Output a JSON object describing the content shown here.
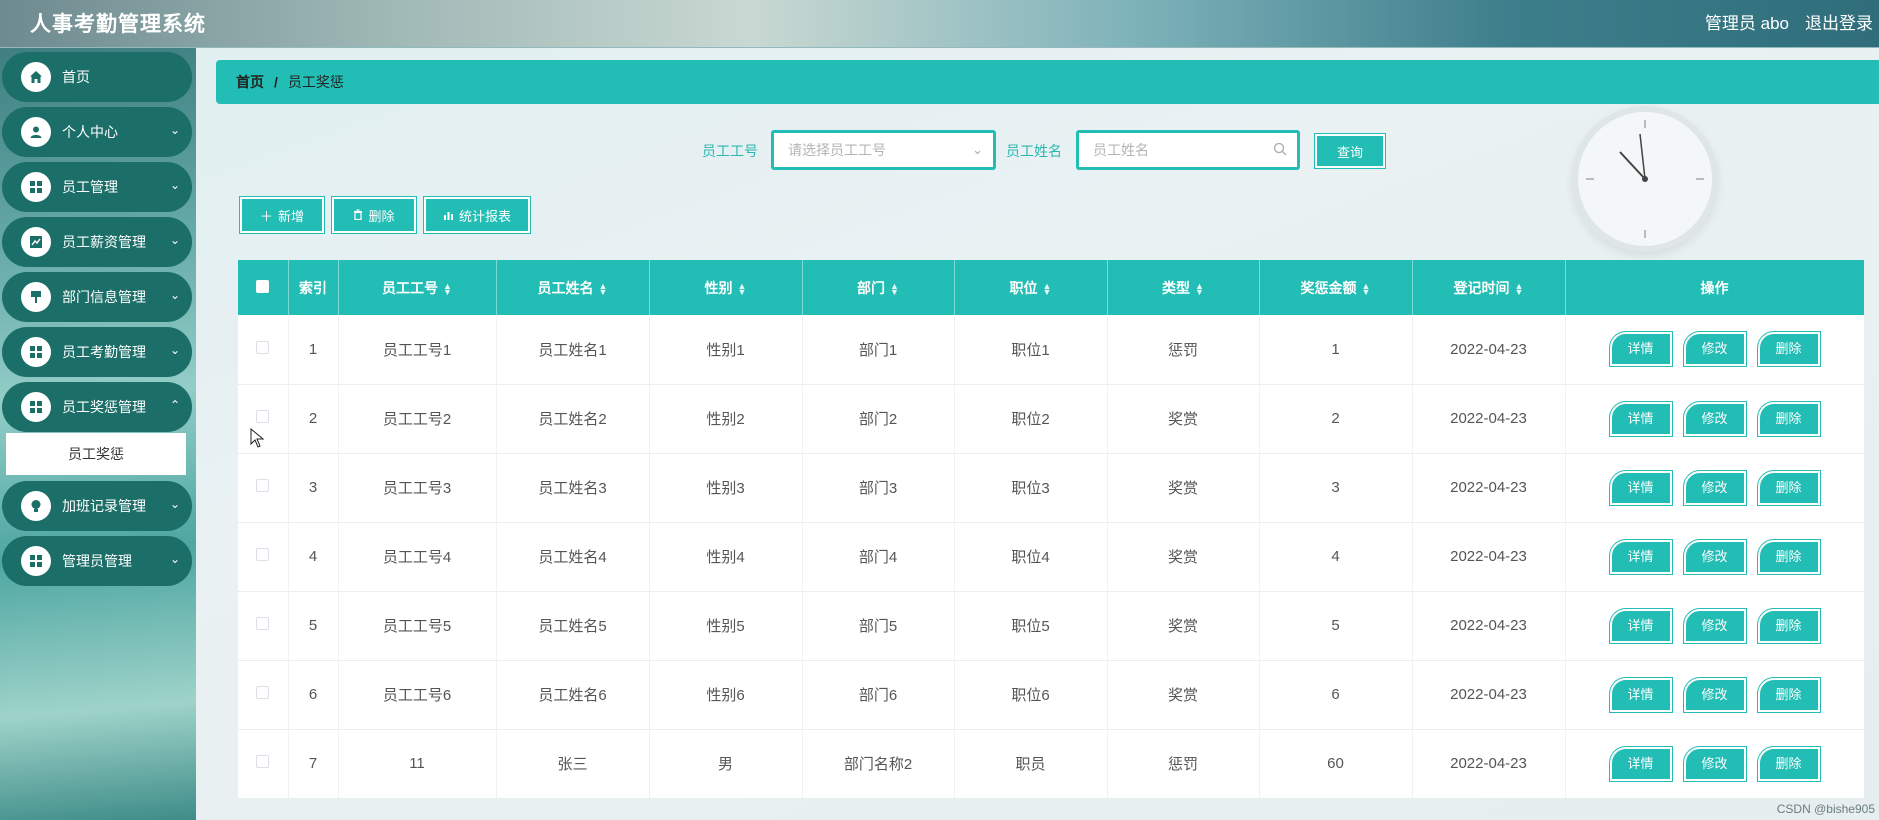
{
  "app": {
    "title": "人事考勤管理系统"
  },
  "header": {
    "admin_label": "管理员 abo",
    "logout_label": "退出登录"
  },
  "sidebar": {
    "items": [
      {
        "label": "首页",
        "icon": "home-icon",
        "chevron": false
      },
      {
        "label": "个人中心",
        "icon": "user-icon",
        "chevron": true
      },
      {
        "label": "员工管理",
        "icon": "grid-icon",
        "chevron": true
      },
      {
        "label": "员工薪资管理",
        "icon": "chart-icon",
        "chevron": true
      },
      {
        "label": "部门信息管理",
        "icon": "signpost-icon",
        "chevron": true
      },
      {
        "label": "员工考勤管理",
        "icon": "grid-icon",
        "chevron": true
      },
      {
        "label": "员工奖惩管理",
        "icon": "grid-icon",
        "chevron": true
      },
      {
        "label": "加班记录管理",
        "icon": "bulb-icon",
        "chevron": true
      },
      {
        "label": "管理员管理",
        "icon": "grid-icon",
        "chevron": true
      }
    ],
    "active_sub": "员工奖惩"
  },
  "breadcrumb": {
    "home": "首页",
    "separator": "/",
    "current": "员工奖惩"
  },
  "search": {
    "emp_no_label": "员工工号",
    "emp_no_placeholder": "请选择员工工号",
    "emp_name_label": "员工姓名",
    "emp_name_placeholder": "员工姓名",
    "query_label": "查询"
  },
  "toolbar": {
    "add_label": "新增",
    "delete_label": "删除",
    "report_label": "统计报表"
  },
  "table": {
    "headers": [
      "索引",
      "员工工号",
      "员工姓名",
      "性别",
      "部门",
      "职位",
      "类型",
      "奖惩金额",
      "登记时间",
      "操作"
    ],
    "rows": [
      [
        "1",
        "员工工号1",
        "员工姓名1",
        "性别1",
        "部门1",
        "职位1",
        "惩罚",
        "1",
        "2022-04-23"
      ],
      [
        "2",
        "员工工号2",
        "员工姓名2",
        "性别2",
        "部门2",
        "职位2",
        "奖赏",
        "2",
        "2022-04-23"
      ],
      [
        "3",
        "员工工号3",
        "员工姓名3",
        "性别3",
        "部门3",
        "职位3",
        "奖赏",
        "3",
        "2022-04-23"
      ],
      [
        "4",
        "员工工号4",
        "员工姓名4",
        "性别4",
        "部门4",
        "职位4",
        "奖赏",
        "4",
        "2022-04-23"
      ],
      [
        "5",
        "员工工号5",
        "员工姓名5",
        "性别5",
        "部门5",
        "职位5",
        "奖赏",
        "5",
        "2022-04-23"
      ],
      [
        "6",
        "员工工号6",
        "员工姓名6",
        "性别6",
        "部门6",
        "职位6",
        "奖赏",
        "6",
        "2022-04-23"
      ],
      [
        "7",
        "11",
        "张三",
        "男",
        "部门名称2",
        "职员",
        "惩罚",
        "60",
        "2022-04-23"
      ]
    ],
    "row_actions": [
      "详情",
      "修改",
      "删除"
    ]
  },
  "watermark": "CSDN @bishe905",
  "colors": {
    "accent": "#22bdb4",
    "sidebar_item": "#1b6f68"
  }
}
